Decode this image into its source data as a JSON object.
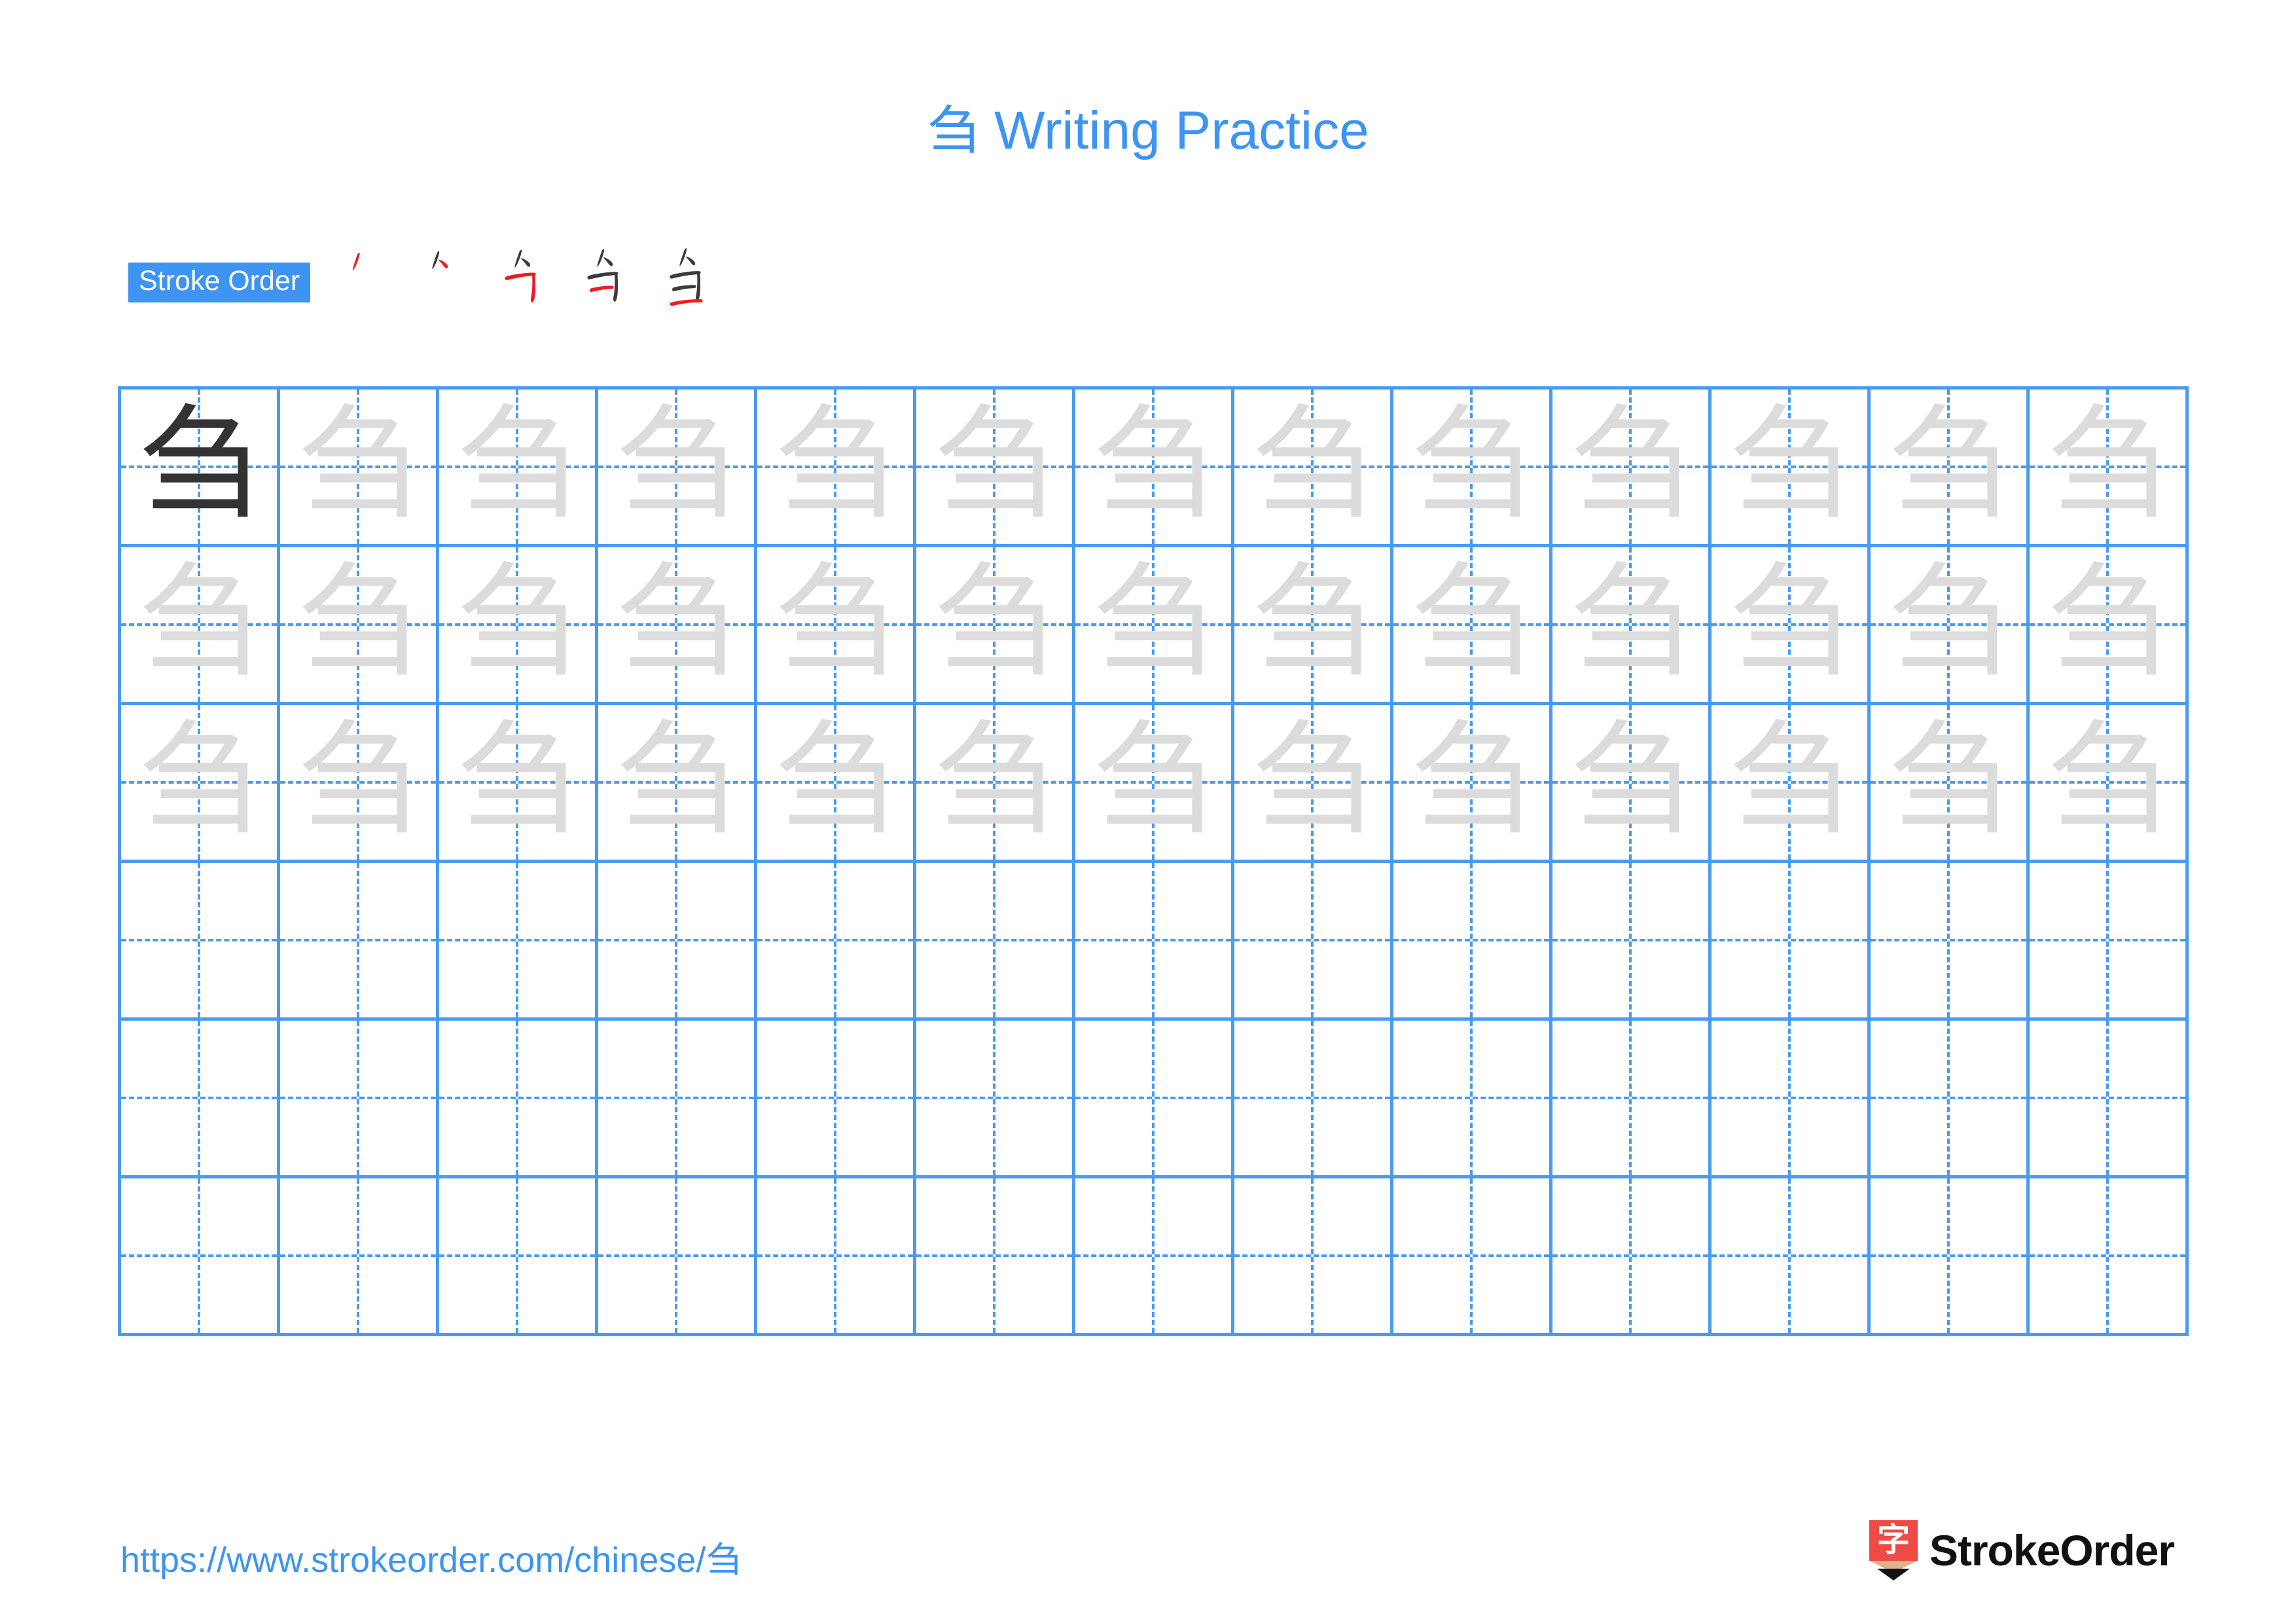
{
  "character": "刍",
  "title": {
    "hanzi": "刍",
    "text": "Writing Practice"
  },
  "stroke_order": {
    "badge_label": "Stroke Order",
    "step_count": 5,
    "steps": [
      {
        "index": 1,
        "new_stroke_color": "#ee1c25",
        "prev_stroke_color": "#3b3b3b",
        "description": "pie"
      },
      {
        "index": 2,
        "new_stroke_color": "#ee1c25",
        "prev_stroke_color": "#3b3b3b",
        "description": "heng-pie"
      },
      {
        "index": 3,
        "new_stroke_color": "#ee1c25",
        "prev_stroke_color": "#3b3b3b",
        "description": "heng-zhe-shu"
      },
      {
        "index": 4,
        "new_stroke_color": "#ee1c25",
        "prev_stroke_color": "#3b3b3b",
        "description": "heng"
      },
      {
        "index": 5,
        "new_stroke_color": "#ee1c25",
        "prev_stroke_color": "#3b3b3b",
        "description": "heng-bottom"
      }
    ]
  },
  "grid": {
    "columns": 13,
    "rows": 6,
    "traced_rows": 3,
    "blank_rows": 3,
    "line_color": "#4a9bf0",
    "dark_char_color": "#333333",
    "trace_char_color": "#dcdcdc",
    "cells": [
      [
        "dark",
        "trace",
        "trace",
        "trace",
        "trace",
        "trace",
        "trace",
        "trace",
        "trace",
        "trace",
        "trace",
        "trace",
        "trace"
      ],
      [
        "trace",
        "trace",
        "trace",
        "trace",
        "trace",
        "trace",
        "trace",
        "trace",
        "trace",
        "trace",
        "trace",
        "trace",
        "trace"
      ],
      [
        "trace",
        "trace",
        "trace",
        "trace",
        "trace",
        "trace",
        "trace",
        "trace",
        "trace",
        "trace",
        "trace",
        "trace",
        "trace"
      ],
      [
        "blank",
        "blank",
        "blank",
        "blank",
        "blank",
        "blank",
        "blank",
        "blank",
        "blank",
        "blank",
        "blank",
        "blank",
        "blank"
      ],
      [
        "blank",
        "blank",
        "blank",
        "blank",
        "blank",
        "blank",
        "blank",
        "blank",
        "blank",
        "blank",
        "blank",
        "blank",
        "blank"
      ],
      [
        "blank",
        "blank",
        "blank",
        "blank",
        "blank",
        "blank",
        "blank",
        "blank",
        "blank",
        "blank",
        "blank",
        "blank",
        "blank"
      ]
    ]
  },
  "footer": {
    "url_prefix": "https://www.strokeorder.com/chinese/",
    "url_hanzi": "刍",
    "brand_name": "StrokeOrder",
    "brand_logo_char": "字",
    "brand_logo_color": "#ef4a45",
    "brand_logo_tip_color": "#d9b48f"
  },
  "colors": {
    "accent_blue": "#3d94f2",
    "grid_blue": "#4a9bf0",
    "stroke_red": "#ee1c25",
    "stroke_dark": "#3b3b3b"
  }
}
